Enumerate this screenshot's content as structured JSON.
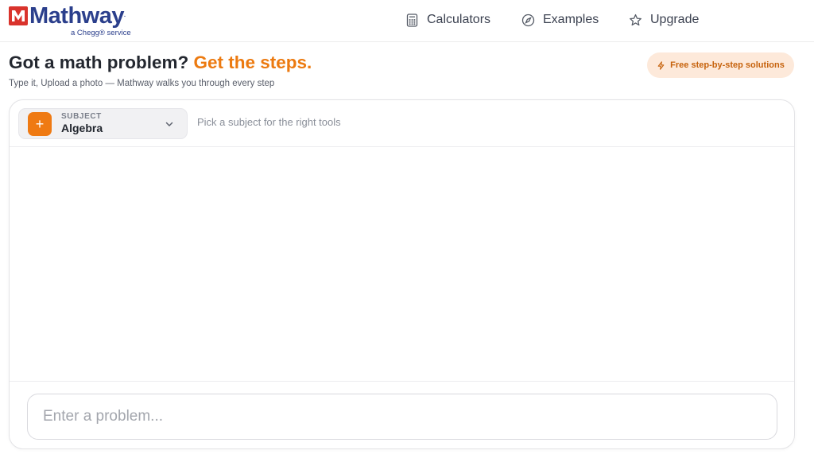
{
  "brand": {
    "name": "Mathway",
    "tagline": "a Chegg® service",
    "colors": {
      "brand_blue": "#2b3f8c",
      "brand_red": "#d9332c",
      "accent_orange": "#ef7a13"
    }
  },
  "nav": {
    "items": [
      {
        "label": "Calculators",
        "icon": "calculator-icon"
      },
      {
        "label": "Examples",
        "icon": "compass-icon"
      },
      {
        "label": "Upgrade",
        "icon": "star-icon"
      }
    ]
  },
  "hero": {
    "headline_start": "Got a math problem? ",
    "headline_accent": "Get the steps.",
    "subtitle": "Type it, Upload a photo — Mathway walks you through every step",
    "promo_label": "Free step-by-step solutions",
    "promo_icon": "lightning-icon"
  },
  "editor": {
    "subject": {
      "caption": "SUBJECT",
      "value": "Algebra",
      "icon": "plus-icon"
    },
    "subject_hint": "Pick a subject for the right tools",
    "input": {
      "value": "",
      "placeholder": "Enter a problem..."
    }
  }
}
